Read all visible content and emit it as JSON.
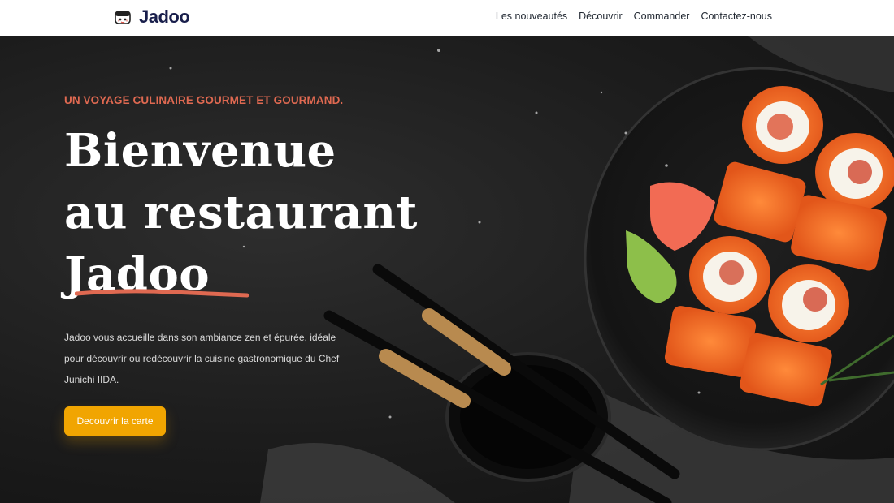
{
  "brand": {
    "name": "Jadoo"
  },
  "nav": {
    "items": [
      {
        "label": "Les nouveautés"
      },
      {
        "label": "Découvrir"
      },
      {
        "label": "Commander"
      },
      {
        "label": "Contactez-nous"
      }
    ]
  },
  "hero": {
    "eyebrow": "UN VOYAGE CULINAIRE GOURMET ET GOURMAND.",
    "headline": [
      "Bienvenue",
      "au restaurant",
      "Jadoo"
    ],
    "description": "Jadoo vous accueille dans son ambiance zen et épurée, idéale pour découvrir ou redécouvrir la cuisine gastronomique du Chef Junichi IIDA.",
    "cta_label": "Decouvrir la carte"
  },
  "colors": {
    "accent": "#df6951",
    "cta": "#f1a501",
    "nav_text": "#212832",
    "brand_text": "#181e4b"
  },
  "icons": [
    "sushi-logo-icon"
  ]
}
